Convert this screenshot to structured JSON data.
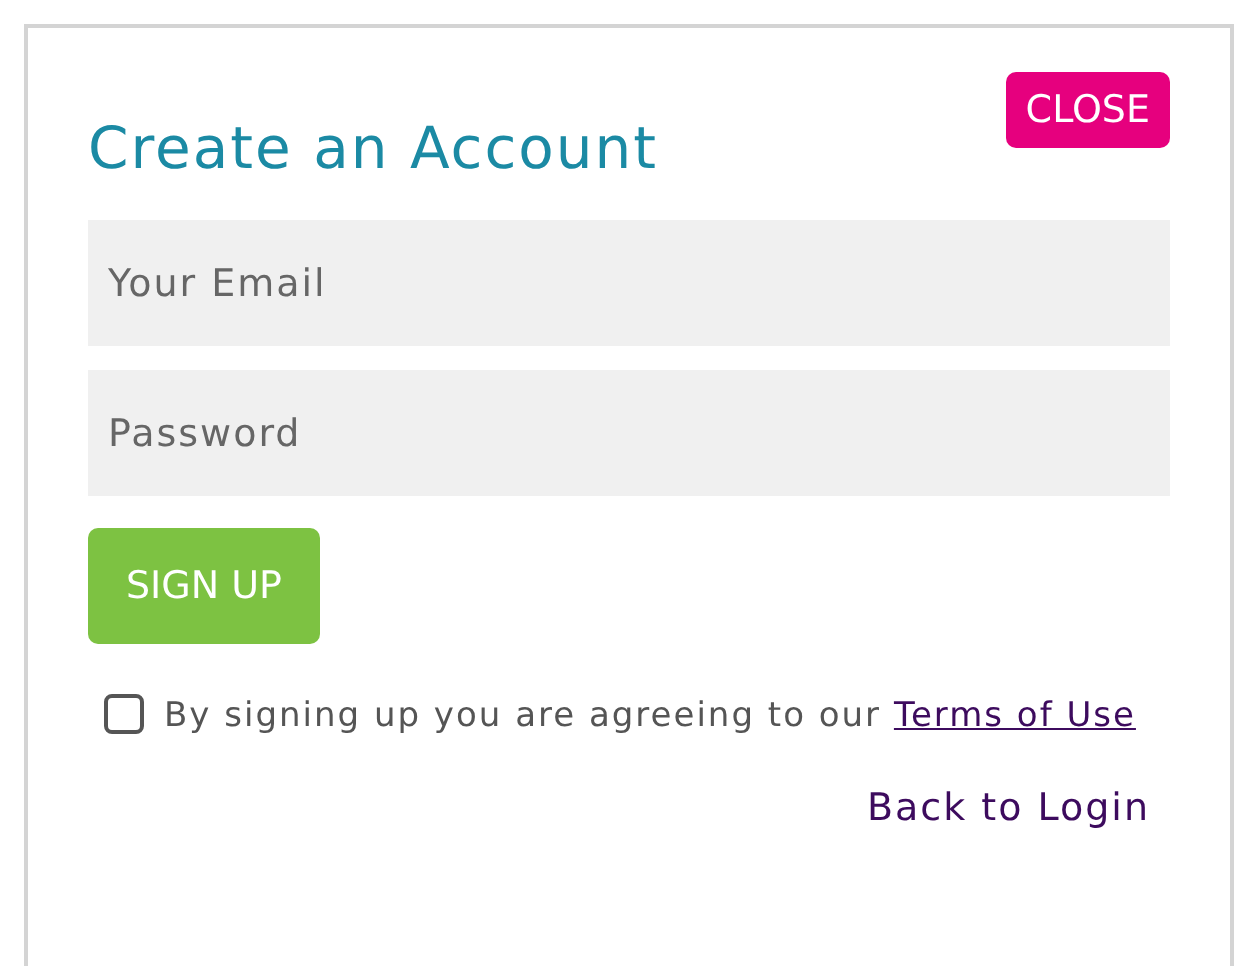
{
  "close_button": {
    "label": "CLOSE"
  },
  "title": "Create an Account",
  "fields": [
    {
      "placeholder": "Your Email"
    },
    {
      "placeholder": "Password"
    }
  ],
  "signup_button": {
    "label": "SIGN UP"
  },
  "terms": {
    "checked": false,
    "text": "By signing up you are agreeing to our",
    "link": "Terms of Use"
  },
  "back_link": "Back to Login"
}
